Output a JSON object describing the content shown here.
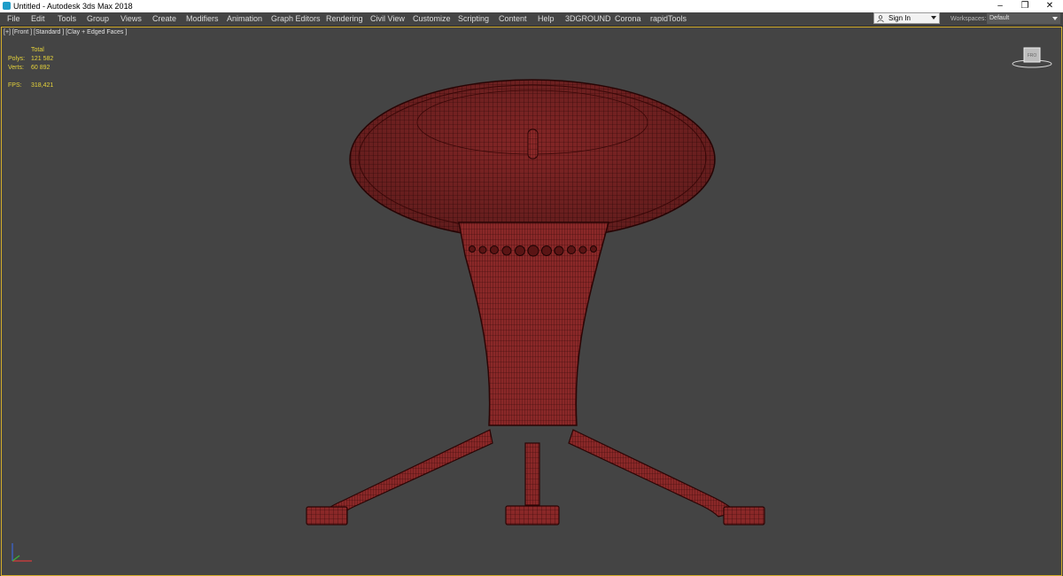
{
  "titlebar": {
    "title": "Untitled - Autodesk 3ds Max 2018",
    "minimize": "–",
    "restore": "❐",
    "close": "✕"
  },
  "menu": [
    "File",
    "Edit",
    "Tools",
    "Group",
    "Views",
    "Create",
    "Modifiers",
    "Animation",
    "Graph Editors",
    "Rendering",
    "Civil View",
    "Customize",
    "Scripting",
    "Content",
    "Help",
    "3DGROUND",
    "Corona",
    "rapidTools"
  ],
  "account": {
    "signin_label": "Sign In"
  },
  "workspaces": {
    "label": "Workspaces:",
    "value": "Default"
  },
  "viewport": {
    "label": "[+] [Front ] [Standard ] [Clay + Edged Faces ]",
    "stats": {
      "header": "Total",
      "polys_label": "Polys:",
      "polys_value": "121 582",
      "verts_label": "Verts:",
      "verts_value": "60 892",
      "fps_label": "FPS:",
      "fps_value": "318,421"
    },
    "viewcube_label": "FRO"
  },
  "colors": {
    "viewport_bg": "#444444",
    "model_fill": "#8a2828",
    "wire": "#2e0606",
    "stats_text": "#e6d33a",
    "active_border": "#d4ad2a"
  },
  "icons": [
    "app-icon",
    "user-icon",
    "dropdown-arrow-icon",
    "minimize-icon",
    "restore-icon",
    "close-icon",
    "viewcube-icon",
    "axis-tripod-icon"
  ]
}
